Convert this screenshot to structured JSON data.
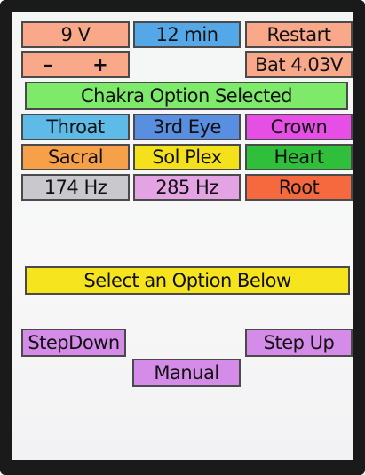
{
  "top_row": {
    "voltage": "9 V",
    "duration": "12 min",
    "restart": "Restart"
  },
  "adjust": {
    "minus": "–",
    "plus": "+"
  },
  "battery": "Bat 4.03V",
  "status_bar": "Chakra Option Selected",
  "chakras": {
    "throat": "Throat",
    "third_eye": "3rd Eye",
    "crown": "Crown",
    "sacral": "Sacral",
    "solar_plexus": "Sol Plex",
    "heart": "Heart",
    "freq_174": "174 Hz",
    "freq_285": "285 Hz",
    "root": "Root"
  },
  "prompt": "Select an Option Below",
  "controls": {
    "step_down": "StepDown",
    "step_up": "Step Up",
    "manual": "Manual"
  },
  "colors": {
    "salmon": "#f9a88a",
    "blue": "#55a8e8",
    "green_status": "#7eea6a",
    "throat": "#5ebbe8",
    "third_eye": "#5a8ee0",
    "crown": "#e64ee6",
    "sacral": "#f7a04a",
    "solar_plexus": "#f5e01c",
    "heart": "#2fbf3a",
    "freq_174": "#c9c9cd",
    "freq_285": "#e4a4e4",
    "root": "#f6683e",
    "prompt": "#f6e41e",
    "controls": "#d48ce8"
  }
}
